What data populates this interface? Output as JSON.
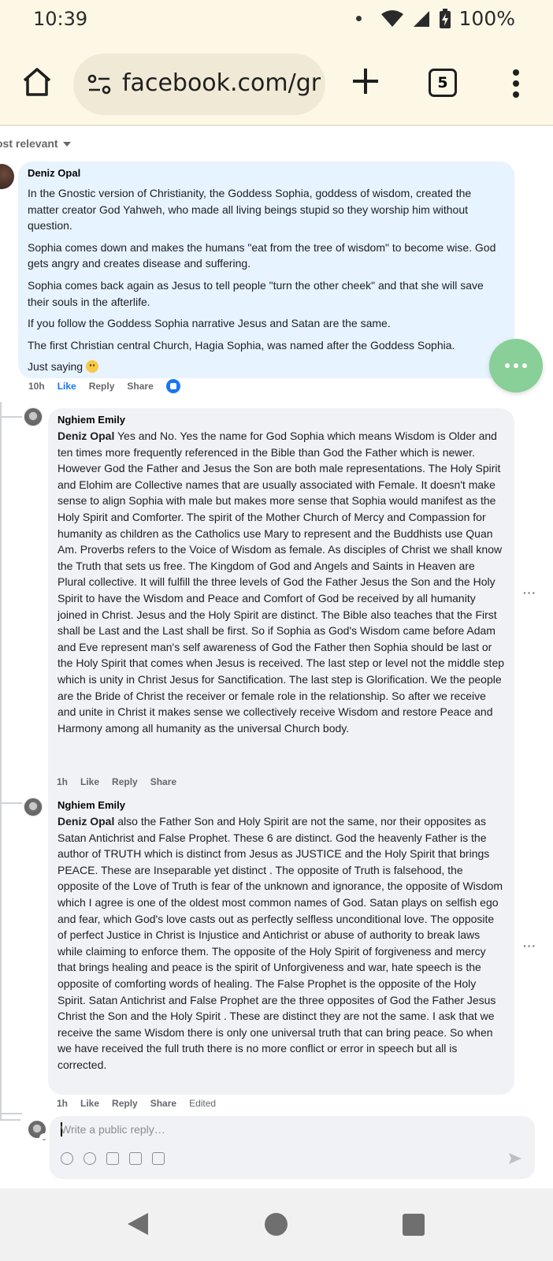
{
  "status_bar": {
    "time": "10:39",
    "battery": "100%"
  },
  "browser": {
    "url": "facebook.com/gr",
    "tab_count": "5"
  },
  "sort": {
    "label": "ost relevant"
  },
  "comments": [
    {
      "author": "Deniz Opal",
      "paragraphs": [
        "In the Gnostic version of Christianity, the Goddess Sophia, goddess of wisdom, created the matter creator God Yahweh, who made all living beings stupid so they worship him without question.",
        "Sophia comes down and makes the humans \"eat from the tree of wisdom\" to become wise. God gets angry and creates disease and suffering.",
        "Sophia comes back again as Jesus to tell people \"turn the other cheek\" and that she will save their souls in the afterlife.",
        "If you follow the Goddess Sophia narrative Jesus and Satan are the same.",
        "The first Christian central Church, Hagia Sophia, was named after the Goddess Sophia.",
        "Just saying"
      ],
      "time": "10h",
      "like": "Like",
      "reply": "Reply",
      "share": "Share"
    },
    {
      "author": "Nghiem Emily",
      "mention": "Deniz Opal",
      "text": " Yes and No. Yes the name for God Sophia which means Wisdom is Older and ten times more frequently referenced in the Bible than God the Father which is newer. However God the Father and Jesus the Son are both male representations. The Holy Spirit and Elohim are Collective names that are usually associated with Female. It doesn't make sense to align Sophia with male but makes more sense that Sophia would manifest as the Holy Spirit and Comforter. The spirit of the Mother Church of Mercy and Compassion for humanity as children as the Catholics use Mary to represent and the Buddhists use Quan Am. Proverbs refers to the Voice of Wisdom as female. As disciples of Christ we shall know the Truth that sets us free. The Kingdom of God and Angels and Saints in Heaven are Plural collective. It will fulfill the three levels of God the Father Jesus the Son and the Holy Spirit to have the Wisdom and Peace and Comfort of God be received by all humanity joined in Christ. Jesus and the Holy Spirit are distinct. The Bible also teaches that the First shall be Last and the Last shall be first. So if Sophia as God's Wisdom came before Adam and Eve represent man's self awareness of God the Father then Sophia should be last or the Holy Spirit that comes when Jesus is received. The last step or level not the middle step which is unity in Christ Jesus for Sanctification. The last step is Glorification. We the people are the Bride of Christ the receiver or female role in the relationship. So after we receive and unite in Christ it makes sense we collectively receive Wisdom and restore Peace and Harmony among all humanity as the universal Church body.",
      "time": "1h",
      "like": "Like",
      "reply": "Reply",
      "share": "Share"
    },
    {
      "author": "Nghiem Emily",
      "mention": "Deniz Opal",
      "text": " also the Father Son and Holy Spirit are not the same, nor their opposites as Satan Antichrist and False Prophet. These 6 are distinct. God the heavenly Father is the author of TRUTH which is distinct from Jesus as JUSTICE and the Holy Spirit that brings PEACE. These are Inseparable yet distinct . The opposite of Truth is falsehood, the opposite of the Love of Truth is fear of the unknown and ignorance, the opposite of Wisdom which I agree is one of the oldest most common names of God. Satan plays on selfish ego and fear, which God's love casts out as perfectly selfless unconditional love. The opposite of perfect Justice in Christ is Injustice and Antichrist or abuse of authority to break laws while claiming to enforce them. The opposite of the Holy Spirit of forgiveness and mercy that brings healing and peace is the spirit of Unforgiveness and war, hate speech is the opposite of comforting words of healing. The False Prophet is the opposite of the Holy Spirit. Satan Antichrist and False Prophet are the three opposites of God the Father Jesus Christ the Son and the Holy Spirit . These are distinct they are not the same. I ask that we receive the same Wisdom there is only one universal truth that can bring peace. So when we have received the full truth there is no more conflict or error in speech but all is corrected.",
      "time": "1h",
      "like": "Like",
      "reply": "Reply",
      "share": "Share",
      "edited": "Edited"
    }
  ],
  "reply_box": {
    "placeholder": "Write a public reply…"
  },
  "more_label": "···",
  "colors": {
    "accent": "#1877f2",
    "browser_bg": "#fdf8e6",
    "fab": "#88cf98",
    "bubble_main": "#e7f3ff",
    "bubble_reply": "#f0f2f5"
  }
}
